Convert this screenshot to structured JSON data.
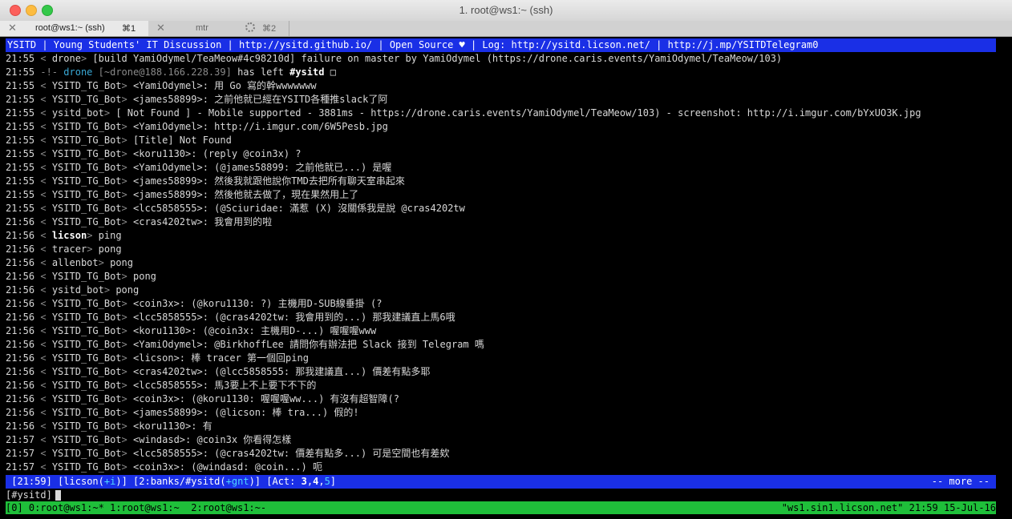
{
  "window": {
    "title": "1. root@ws1:~ (ssh)"
  },
  "tabs": [
    {
      "name": "root@ws1:~ (ssh)",
      "shortcut": "⌘1"
    },
    {
      "name": "mtr",
      "shortcut": "⌘2"
    }
  ],
  "topic": "YSITD | Young Students' IT Discussion | http://ysitd.github.io/ | Open Source ♥ | Log: http://ysitd.licson.net/ | http://j.mp/YSITDTelegram0",
  "messages": [
    {
      "time": "21:55",
      "nick": "drone",
      "text": "[build YamiOdymel/TeaMeow#4c98210d] failure on master by YamiOdymel (https://drone.caris.events/YamiOdymel/TeaMeow/103)"
    },
    {
      "time": "21:55",
      "type": "part",
      "nick": "drone",
      "host": "~drone@188.166.228.39",
      "action": "has left",
      "channel": "#ysitd"
    },
    {
      "time": "21:55",
      "nick": "YSITD_TG_Bot",
      "text": "<YamiOdymel>: 用 Go 寫的幹wwwwwww"
    },
    {
      "time": "21:55",
      "nick": "YSITD_TG_Bot",
      "text": "<james58899>: 之前他就已經在YSITD各種推slack了阿"
    },
    {
      "time": "21:55",
      "nick": "ysitd_bot",
      "text": "[ Not Found ] - Mobile supported - 3881ms - https://drone.caris.events/YamiOdymel/TeaMeow/103) - screenshot: http://i.imgur.com/bYxUO3K.jpg"
    },
    {
      "time": "21:55",
      "nick": "YSITD_TG_Bot",
      "text": "<YamiOdymel>: http://i.imgur.com/6W5Pesb.jpg"
    },
    {
      "time": "21:55",
      "nick": "YSITD_TG_Bot",
      "text": "[Title] Not Found"
    },
    {
      "time": "21:55",
      "nick": "YSITD_TG_Bot",
      "text": "<koru1130>: (reply @coin3x) ?"
    },
    {
      "time": "21:55",
      "nick": "YSITD_TG_Bot",
      "text": "<YamiOdymel>: (@james58899: 之前他就已...) 是喔"
    },
    {
      "time": "21:55",
      "nick": "YSITD_TG_Bot",
      "text": "<james58899>: 然後我就跟他說你TMD去把所有聊天室串起來"
    },
    {
      "time": "21:55",
      "nick": "YSITD_TG_Bot",
      "text": "<james58899>: 然後他就去做了，現在果然用上了"
    },
    {
      "time": "21:55",
      "nick": "YSITD_TG_Bot",
      "text": "<lcc5858555>: (@Sciuridae: 滿惹 (X) 沒關係我是說 @cras4202tw"
    },
    {
      "time": "21:56",
      "nick": "YSITD_TG_Bot",
      "text": "<cras4202tw>: 我會用到的啦"
    },
    {
      "time": "21:56",
      "nick": "licson",
      "self": true,
      "text": "ping"
    },
    {
      "time": "21:56",
      "nick": "tracer",
      "text": "pong"
    },
    {
      "time": "21:56",
      "nick": "allenbot",
      "text": "pong"
    },
    {
      "time": "21:56",
      "nick": "YSITD_TG_Bot",
      "text": "pong"
    },
    {
      "time": "21:56",
      "nick": "ysitd_bot",
      "text": "pong"
    },
    {
      "time": "21:56",
      "nick": "YSITD_TG_Bot",
      "text": "<coin3x>: (@koru1130: ?) 主機用D-SUB線垂掛 (?"
    },
    {
      "time": "21:56",
      "nick": "YSITD_TG_Bot",
      "text": "<lcc5858555>: (@cras4202tw: 我會用到的...) 那我建議直上馬6哦"
    },
    {
      "time": "21:56",
      "nick": "YSITD_TG_Bot",
      "text": "<koru1130>: (@coin3x: 主機用D-...) 喔喔喔www"
    },
    {
      "time": "21:56",
      "nick": "YSITD_TG_Bot",
      "text": "<YamiOdymel>: @BirkhoffLee 請問你有辦法把 Slack 接到 Telegram 嗎"
    },
    {
      "time": "21:56",
      "nick": "YSITD_TG_Bot",
      "text": "<licson>: 棒 tracer 第一個回ping"
    },
    {
      "time": "21:56",
      "nick": "YSITD_TG_Bot",
      "text": "<cras4202tw>: (@lcc5858555: 那我建議直...) 價差有點多耶"
    },
    {
      "time": "21:56",
      "nick": "YSITD_TG_Bot",
      "text": "<lcc5858555>: 馬3要上不上要下不下的"
    },
    {
      "time": "21:56",
      "nick": "YSITD_TG_Bot",
      "text": "<coin3x>: (@koru1130: 喔喔喔ww...) 有沒有超智障(?"
    },
    {
      "time": "21:56",
      "nick": "YSITD_TG_Bot",
      "text": "<james58899>: (@licson: 棒 tra...) 假的!"
    },
    {
      "time": "21:56",
      "nick": "YSITD_TG_Bot",
      "text": "<koru1130>: 有"
    },
    {
      "time": "21:57",
      "nick": "YSITD_TG_Bot",
      "text": "<windasd>: @coin3x 你看得怎樣"
    },
    {
      "time": "21:57",
      "nick": "YSITD_TG_Bot",
      "text": "<lcc5858555>: (@cras4202tw: 價差有點多...) 可是空間也有差欸"
    },
    {
      "time": "21:57",
      "nick": "YSITD_TG_Bot",
      "text": "<coin3x>: (@windasd: @coin...) 呃"
    }
  ],
  "status": {
    "time": "21:59",
    "nick": "licson",
    "mode": "+i",
    "window": "2:banks/#ysitd",
    "chanmode": "+gnt",
    "act_label": "Act:",
    "act": [
      "3",
      "4",
      "5"
    ],
    "more": "-- more --"
  },
  "input": {
    "prompt": "[#ysitd]"
  },
  "tmux": {
    "left": "[0] 0:root@ws1:~* 1:root@ws1:~  2:root@ws1:~-",
    "right": "\"ws1.sin1.licson.net\" 21:59 15-Jul-16"
  },
  "colors": {
    "topic_bg": "#1a2fe6",
    "tmux_bg": "#1fbf3a",
    "drone": "#39a9d6"
  }
}
